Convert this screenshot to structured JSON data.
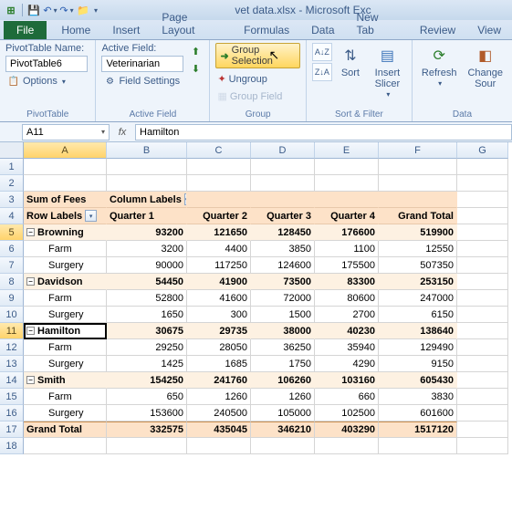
{
  "title": "vet data.xlsx - Microsoft Exc",
  "tabs": [
    "File",
    "Home",
    "Insert",
    "Page Layout",
    "Formulas",
    "Data",
    "New Tab",
    "Review",
    "View"
  ],
  "pivottable_group": {
    "label": "PivotTable",
    "name_label": "PivotTable Name:",
    "name_value": "PivotTable6",
    "options_label": "Options"
  },
  "activefield_group": {
    "label": "Active Field",
    "af_label": "Active Field:",
    "af_value": "Veterinarian",
    "settings_label": "Field Settings"
  },
  "group_group": {
    "label": "Group",
    "selection": "Group Selection",
    "ungroup": "Ungroup",
    "field": "Group Field"
  },
  "sortfilter_group": {
    "label": "Sort & Filter",
    "sort": "Sort",
    "slicer": "Insert Slicer"
  },
  "data_group": {
    "label": "Data",
    "refresh": "Refresh",
    "change": "Change Sour"
  },
  "namebox": "A11",
  "formula": "Hamilton",
  "cols": [
    "A",
    "B",
    "C",
    "D",
    "E",
    "F",
    "G"
  ],
  "pivot": {
    "sum_label": "Sum of Fees",
    "col_labels": "Column Labels",
    "row_labels": "Row Labels",
    "quarters": [
      "Quarter 1",
      "Quarter 2",
      "Quarter 3",
      "Quarter 4"
    ],
    "grand_total": "Grand Total",
    "rows": [
      {
        "name": "Browning",
        "vals": [
          93200,
          121650,
          128450,
          176600,
          519900
        ],
        "children": [
          {
            "name": "Farm",
            "vals": [
              3200,
              4400,
              3850,
              1100,
              12550
            ]
          },
          {
            "name": "Surgery",
            "vals": [
              90000,
              117250,
              124600,
              175500,
              507350
            ]
          }
        ]
      },
      {
        "name": "Davidson",
        "vals": [
          54450,
          41900,
          73500,
          83300,
          253150
        ],
        "children": [
          {
            "name": "Farm",
            "vals": [
              52800,
              41600,
              72000,
              80600,
              247000
            ]
          },
          {
            "name": "Surgery",
            "vals": [
              1650,
              300,
              1500,
              2700,
              6150
            ]
          }
        ]
      },
      {
        "name": "Hamilton",
        "vals": [
          30675,
          29735,
          38000,
          40230,
          138640
        ],
        "children": [
          {
            "name": "Farm",
            "vals": [
              29250,
              28050,
              36250,
              35940,
              129490
            ]
          },
          {
            "name": "Surgery",
            "vals": [
              1425,
              1685,
              1750,
              4290,
              9150
            ]
          }
        ]
      },
      {
        "name": "Smith",
        "vals": [
          154250,
          241760,
          106260,
          103160,
          605430
        ],
        "children": [
          {
            "name": "Farm",
            "vals": [
              650,
              1260,
              1260,
              660,
              3830
            ]
          },
          {
            "name": "Surgery",
            "vals": [
              153600,
              240500,
              105000,
              102500,
              601600
            ]
          }
        ]
      }
    ],
    "grand_vals": [
      332575,
      435045,
      346210,
      403290,
      1517120
    ]
  }
}
